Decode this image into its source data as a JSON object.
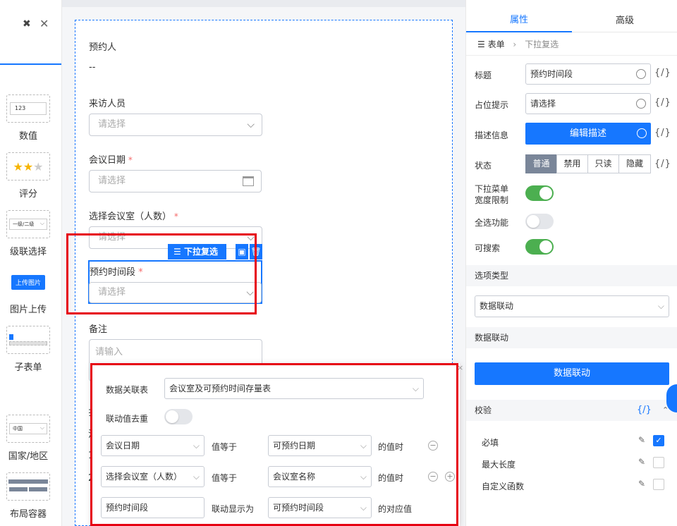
{
  "left_panel": {
    "widgets": [
      {
        "label": "数值",
        "preview": "123"
      },
      {
        "label": "评分",
        "preview": "★★★"
      },
      {
        "label": "级联选择",
        "preview": "一级/二级"
      },
      {
        "label": "图片上传",
        "preview": "上传图片"
      },
      {
        "label": "子表单",
        "preview": ""
      },
      {
        "label": "国家/地区",
        "preview": "中国"
      },
      {
        "label": "布局容器",
        "preview": ""
      }
    ]
  },
  "form": {
    "booker_label": "预约人",
    "booker_value": "--",
    "visitor_label": "来访人员",
    "visitor_placeholder": "请选择",
    "date_label": "会议日期",
    "date_placeholder": "请选择",
    "room_label": "选择会议室（人数）",
    "room_placeholder": "请选择",
    "time_label": "预约时间段",
    "time_placeholder": "请选择",
    "remark_label": "备注",
    "remark_placeholder": "请输入",
    "required_mark": "*",
    "selected_tag": "下拉复选",
    "partial_1": "扌",
    "partial_2": "汢",
    "partial_3": "1",
    "partial_4": "2"
  },
  "popup": {
    "table_label": "数据关联表",
    "table_value": "会议室及可预约时间存量表",
    "dedupe_label": "联动值去重",
    "rows": [
      {
        "left": "会议日期",
        "op": "值等于",
        "right": "可预约日期",
        "suffix": "的值时"
      },
      {
        "left": "选择会议室（人数）",
        "op": "值等于",
        "right": "会议室名称",
        "suffix": "的值时"
      },
      {
        "left": "预约时间段",
        "op": "联动显示为",
        "right": "可预约时间段",
        "suffix": "的对应值"
      }
    ],
    "minus": "−",
    "plus": "+",
    "close": "×"
  },
  "right_panel": {
    "tabs": [
      "属性",
      "高级"
    ],
    "crumb_root": "表单",
    "crumb_sep": "›",
    "crumb_current": "下拉复选",
    "title_label": "标题",
    "title_value": "预约时间段",
    "placeholder_label": "占位提示",
    "placeholder_value": "请选择",
    "desc_label": "描述信息",
    "desc_button": "编辑描述",
    "status_label": "状态",
    "status_options": [
      "普通",
      "禁用",
      "只读",
      "隐藏"
    ],
    "width_limit_label_1": "下拉菜单",
    "width_limit_label_2": "宽度限制",
    "select_all_label": "全选功能",
    "searchable_label": "可搜索",
    "option_type_section": "选项类型",
    "option_type_value": "数据联动",
    "linkage_section": "数据联动",
    "linkage_button": "数据联动",
    "validation_section": "校验",
    "code_icon_text": "{/}",
    "required_label": "必填",
    "maxlen_label": "最大长度",
    "custom_fn_label": "自定义函数"
  },
  "colors": {
    "accent": "#1677ff",
    "toggle_on": "#4caf50",
    "highlight": "#e60012"
  }
}
